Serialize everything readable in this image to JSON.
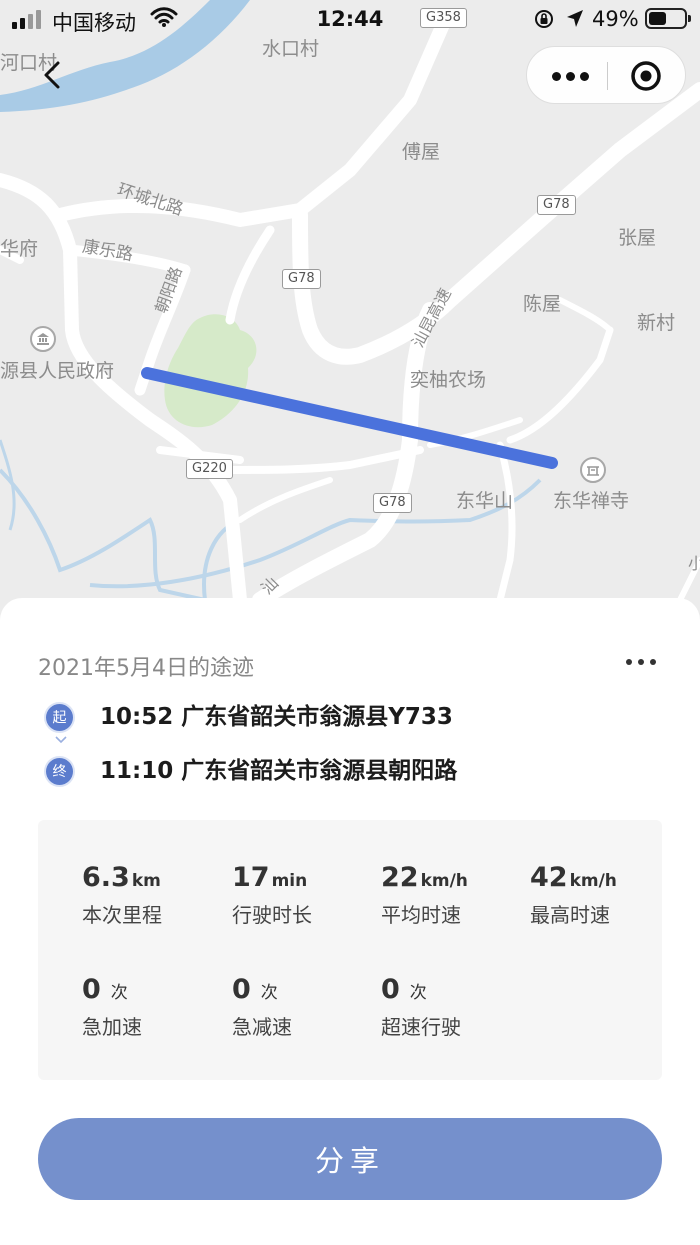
{
  "status_bar": {
    "carrier": "中国移动",
    "time": "12:44",
    "battery_percent": "49%",
    "battery_level": 0.49
  },
  "map": {
    "labels": {
      "hekou": "河口村",
      "shuikou": "水口村",
      "fuwu": "傅屋",
      "huancheng": "环城北路",
      "kangle": "康乐路",
      "chaoyang": "朝阳路",
      "fu": "华府",
      "zhangwu": "张屋",
      "chenwu": "陈屋",
      "xincun": "新村",
      "zhengfu": "源县人民政府",
      "nongchang": "奕柚农场",
      "donghuashan": "东华山",
      "chansi": "东华禅寺",
      "gaosu": "汕昆高速",
      "gaosu2": "汕",
      "xiao": "小"
    },
    "road_badges": {
      "g358": "G358",
      "g78_a": "G78",
      "g78_b": "G78",
      "g78_c": "G78",
      "g220": "G220"
    },
    "route_color": "#4b72dc"
  },
  "trip": {
    "title": "2021年5月4日的途迹",
    "start": {
      "badge": "起",
      "text": "10:52 广东省韶关市翁源县Y733"
    },
    "end": {
      "badge": "终",
      "text": "11:10 广东省韶关市翁源县朝阳路"
    }
  },
  "stats": [
    {
      "value": "6.3",
      "unit": "km",
      "label": "本次里程"
    },
    {
      "value": "17",
      "unit": "min",
      "label": "行驶时长"
    },
    {
      "value": "22",
      "unit": "km/h",
      "label": "平均时速"
    },
    {
      "value": "42",
      "unit": "km/h",
      "label": "最高时速"
    },
    {
      "value": "0",
      "unit": "次",
      "label": "急加速"
    },
    {
      "value": "0",
      "unit": "次",
      "label": "急减速"
    },
    {
      "value": "0",
      "unit": "次",
      "label": "超速行驶"
    }
  ],
  "share_label": "分享",
  "colors": {
    "accent": "#7590cc",
    "badge": "#5b7ccd"
  }
}
